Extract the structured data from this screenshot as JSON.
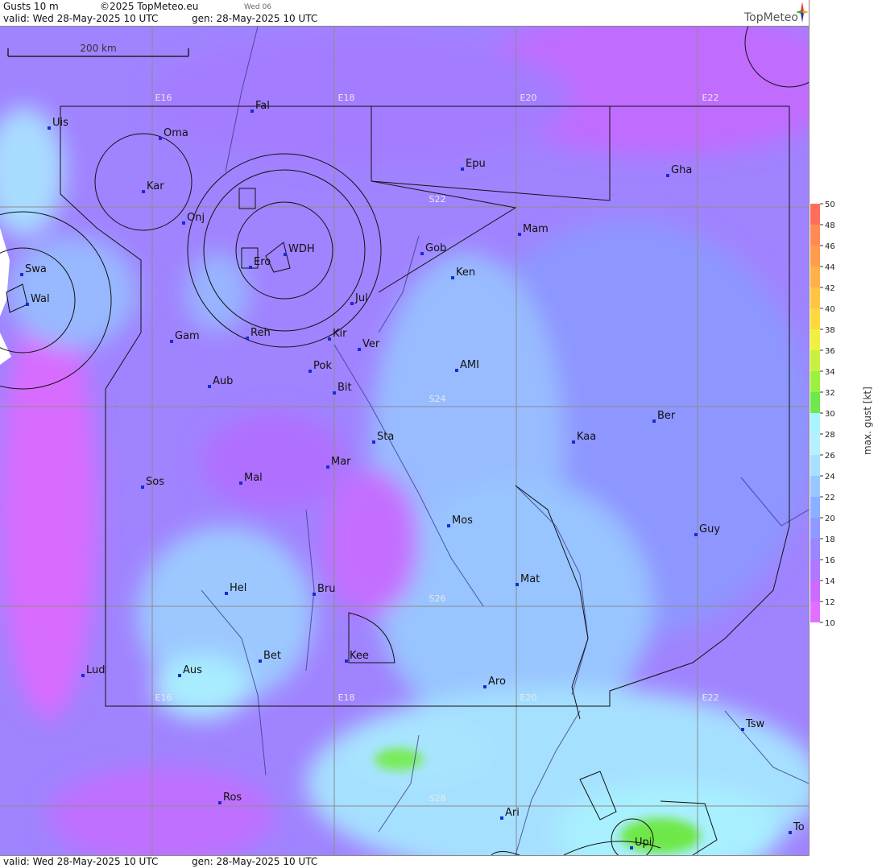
{
  "header": {
    "product": "Gusts 10 m",
    "copyright": "©2025 TopMeteo.eu",
    "day_small": "Wed 06",
    "valid": "valid:  Wed  28-May-2025  10 UTC",
    "gen": "gen: 28-May-2025 10 UTC",
    "logo": "TopMeteo"
  },
  "footer": {
    "valid": "valid:  Wed  28-May-2025  10 UTC",
    "gen": "gen: 28-May-2025 10 UTC"
  },
  "scale_bar": "200 km",
  "grid_labels": {
    "lon": [
      "E16",
      "E18",
      "E20",
      "E22"
    ],
    "lat": [
      "S22",
      "S24",
      "S26",
      "S28"
    ]
  },
  "places": [
    "Uis",
    "Fal",
    "Oma",
    "Kar",
    "Onj",
    "Epu",
    "Gha",
    "Mam",
    "Gob",
    "Ken",
    "WDH",
    "Ero",
    "Swa",
    "Wal",
    "Jul",
    "Gam",
    "Reh",
    "Kir",
    "Ver",
    "Pok",
    "AMI",
    "Aub",
    "Bit",
    "Ber",
    "Kaa",
    "Sta",
    "Mar",
    "Sos",
    "Mal",
    "Mos",
    "Guy",
    "Hel",
    "Bru",
    "Mat",
    "Bet",
    "Kee",
    "Lud",
    "Aus",
    "Aro",
    "Tsw",
    "Ros",
    "Ari",
    "Upi",
    "To"
  ],
  "legend": {
    "title": "max. gust [kt]",
    "ticks": [
      "50",
      "48",
      "46",
      "44",
      "42",
      "40",
      "38",
      "36",
      "34",
      "32",
      "30",
      "28",
      "26",
      "24",
      "22",
      "20",
      "18",
      "16",
      "14",
      "12",
      "10"
    ],
    "colors": [
      "#ff6e5a",
      "#ff8a54",
      "#ff9c4e",
      "#ffb048",
      "#ffc442",
      "#ffd840",
      "#f0f040",
      "#c8f040",
      "#9cf040",
      "#6ee84a",
      "#a8f4ff",
      "#b4f0ff",
      "#a8e0ff",
      "#98c8ff",
      "#8ab0ff",
      "#8e9aff",
      "#9a86ff",
      "#b078ff",
      "#cc6cff",
      "#e070ff"
    ]
  }
}
